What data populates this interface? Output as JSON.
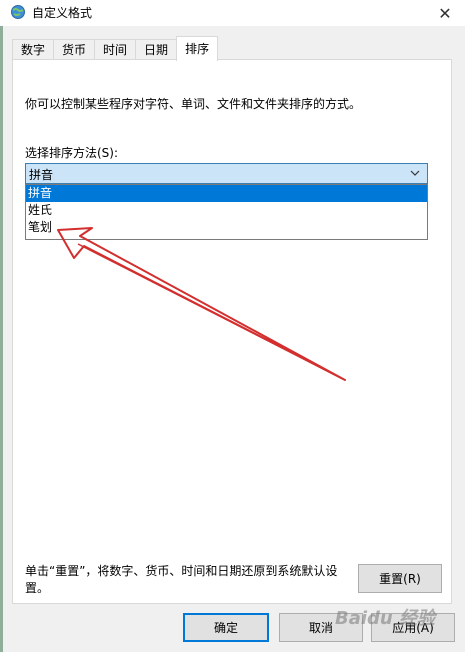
{
  "window": {
    "title": "自定义格式",
    "close_glyph": "✕"
  },
  "tabs": [
    {
      "label": "数字",
      "active": false
    },
    {
      "label": "货币",
      "active": false
    },
    {
      "label": "时间",
      "active": false
    },
    {
      "label": "日期",
      "active": false
    },
    {
      "label": "排序",
      "active": true
    }
  ],
  "panel": {
    "description": "你可以控制某些程序对字符、单词、文件和文件夹排序的方式。",
    "sort_label": "选择排序方法(S):",
    "select_value": "拼音",
    "options": [
      "拼音",
      "姓氏",
      "笔划"
    ],
    "footer_text": "单击“重置”，将数字、货币、时间和日期还原到系统默认设置。",
    "reset_label": "重置(R)"
  },
  "buttons": {
    "ok": "确定",
    "cancel": "取消",
    "apply": "应用(A)"
  },
  "watermark": "Baidu 经验",
  "colors": {
    "accent": "#0078d7",
    "select_bg": "#cce4f7",
    "annotation_arrow": "#d32f2f"
  }
}
